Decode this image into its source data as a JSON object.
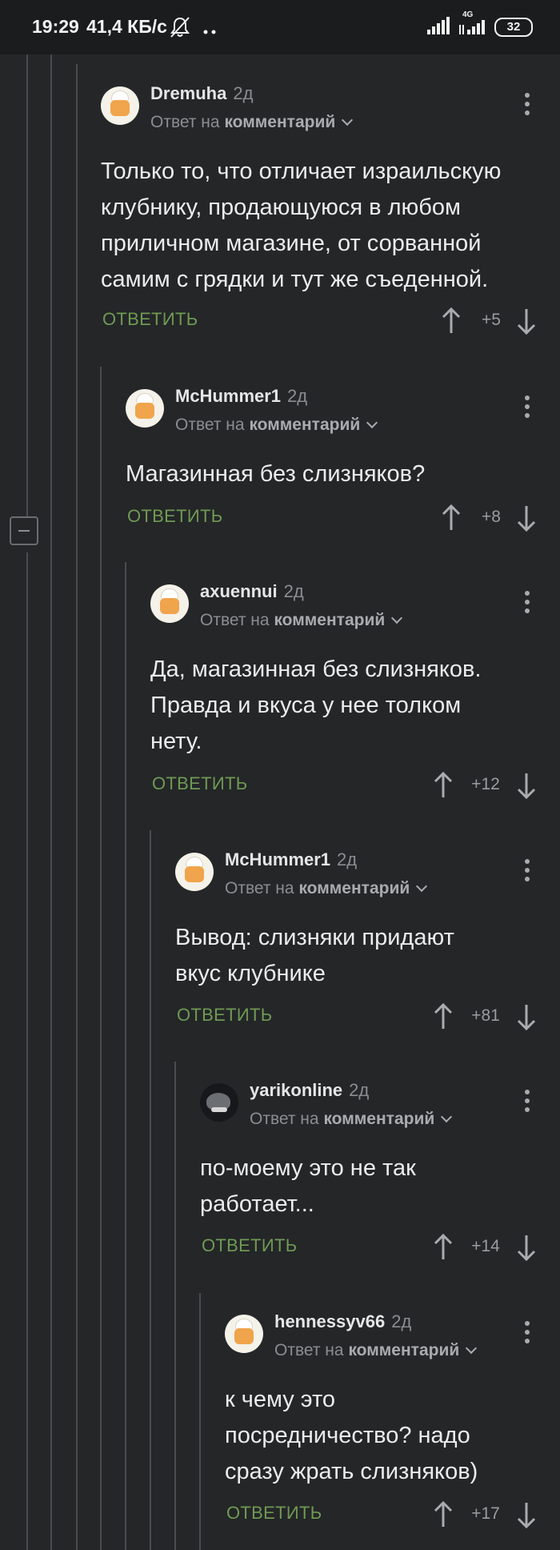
{
  "status_bar": {
    "time": "19:29",
    "speed": "41,4 КБ/с",
    "network": "4G",
    "battery": "32",
    "icons": [
      "mute-icon",
      "dots-icon",
      "signal-icon",
      "signal-4g-icon",
      "battery-icon"
    ]
  },
  "labels": {
    "reply_prefix": "Ответ на",
    "reply_target": "комментарий",
    "reply_button": "ОТВЕТИТЬ"
  },
  "colors": {
    "background": "#242628",
    "reply_button": "#6f9a53",
    "thread_line": "#4a4c4f"
  },
  "comments": [
    {
      "author": "Dremuha",
      "time": "2д",
      "avatar": "chef-avatar",
      "lines": [
        "Только то, что отличает израильскую",
        "клубнику, продающуюся в любом",
        "приличном магазине, от сорванной",
        "самим с грядки и тут же съеденной."
      ],
      "score": "+5"
    },
    {
      "author": "McHummer1",
      "time": "2д",
      "avatar": "chef-avatar",
      "lines": [
        "Магазинная без слизняков?"
      ],
      "score": "+8"
    },
    {
      "author": "axuennui",
      "time": "2д",
      "avatar": "chef-avatar",
      "lines": [
        "Да, магазинная без слизняков.",
        "Правда и вкуса у нее толком",
        "нету."
      ],
      "score": "+12"
    },
    {
      "author": "McHummer1",
      "time": "2д",
      "avatar": "chef-avatar",
      "lines": [
        "Вывод: слизняки придают",
        "вкус клубнике"
      ],
      "score": "+81"
    },
    {
      "author": "yarikonline",
      "time": "2д",
      "avatar": "dark-photo-avatar",
      "lines": [
        "по-моему это не так",
        "работает..."
      ],
      "score": "+14"
    },
    {
      "author": "hennessyv66",
      "time": "2д",
      "avatar": "chef-avatar",
      "lines": [
        "к чему это",
        "посредничество? надо",
        "сразу жрать слизняков)"
      ],
      "score": "+17"
    }
  ]
}
